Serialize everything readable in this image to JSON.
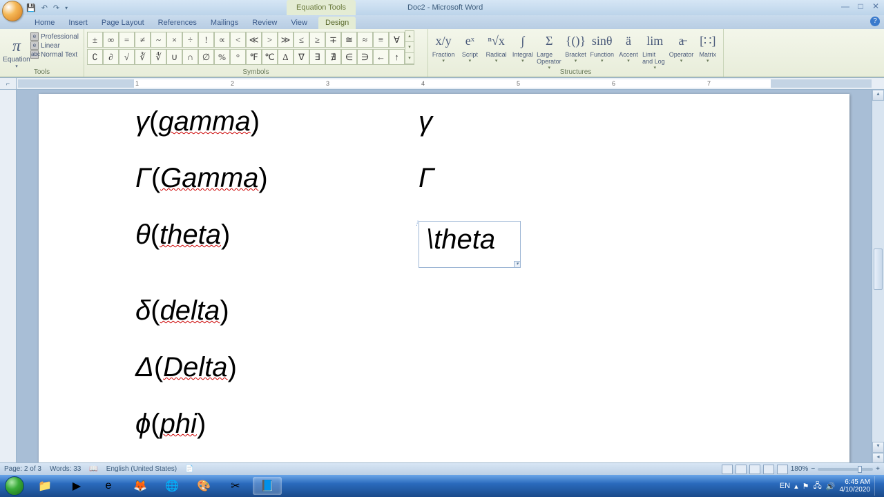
{
  "titlebar": {
    "context_tab": "Equation Tools",
    "doc_title": "Doc2 - Microsoft Word"
  },
  "tabs": [
    "Home",
    "Insert",
    "Page Layout",
    "References",
    "Mailings",
    "Review",
    "View",
    "Design"
  ],
  "active_tab_index": 7,
  "tools_group": {
    "label": "Tools",
    "equation": "Equation",
    "opts": [
      "Professional",
      "Linear",
      "Normal Text"
    ]
  },
  "symbols_group": {
    "label": "Symbols",
    "row1": [
      "±",
      "∞",
      "=",
      "≠",
      "~",
      "×",
      "÷",
      "!",
      "∝",
      "<",
      "≪",
      ">",
      "≫",
      "≤",
      "≥",
      "∓",
      "≅",
      "≈",
      "≡",
      "∀"
    ],
    "row2": [
      "∁",
      "∂",
      "√",
      "∛",
      "∜",
      "∪",
      "∩",
      "∅",
      "%",
      "°",
      "℉",
      "℃",
      "∆",
      "∇",
      "∃",
      "∄",
      "∈",
      "∋",
      "←",
      "↑"
    ]
  },
  "structures_group": {
    "label": "Structures",
    "items": [
      {
        "icon": "x/y",
        "label": "Fraction"
      },
      {
        "icon": "eˣ",
        "label": "Script"
      },
      {
        "icon": "ⁿ√x",
        "label": "Radical"
      },
      {
        "icon": "∫",
        "label": "Integral"
      },
      {
        "icon": "Σ",
        "label": "Large Operator"
      },
      {
        "icon": "{()}",
        "label": "Bracket"
      },
      {
        "icon": "sinθ",
        "label": "Function"
      },
      {
        "icon": "ä",
        "label": "Accent"
      },
      {
        "icon": "lim",
        "label": "Limit and Log"
      },
      {
        "icon": "a̶",
        "label": "Operator"
      },
      {
        "icon": "[∷]",
        "label": "Matrix"
      }
    ]
  },
  "ruler_numbers": [
    "1",
    "2",
    "3",
    "4",
    "5",
    "6",
    "7"
  ],
  "document": {
    "rows": [
      {
        "sym": "γ",
        "name": "gamma",
        "right": "γ",
        "right_box": false
      },
      {
        "sym": "Γ",
        "name": "Gamma",
        "right": "Γ",
        "right_box": false
      },
      {
        "sym": "θ",
        "name": "theta",
        "right": "\\theta",
        "right_box": true
      },
      {
        "sym": "δ",
        "name": "delta",
        "right": "",
        "right_box": false
      },
      {
        "sym": "Δ",
        "name": "Delta",
        "right": "",
        "right_box": false
      },
      {
        "sym": "ϕ",
        "name": "phi",
        "right": "",
        "right_box": false
      }
    ]
  },
  "statusbar": {
    "page": "Page: 2 of 3",
    "words": "Words: 33",
    "lang": "English (United States)",
    "zoom": "180%"
  },
  "tray": {
    "lang": "EN",
    "time": "6:45 AM",
    "date": "4/10/2020"
  }
}
